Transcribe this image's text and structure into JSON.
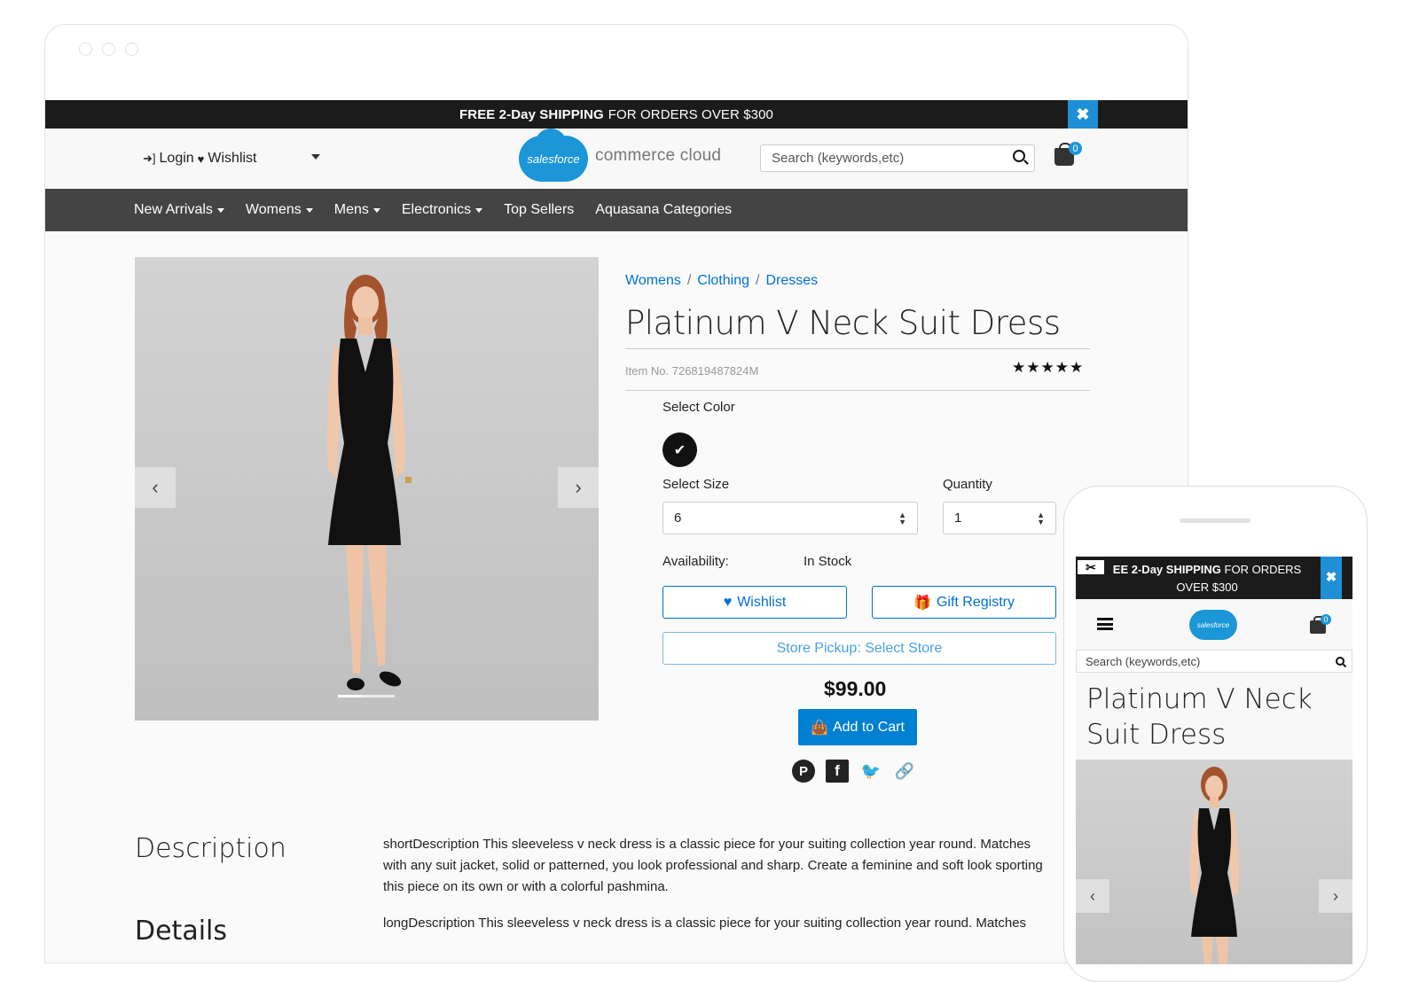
{
  "promo": {
    "bold": "FREE 2-Day SHIPPING",
    "rest": "FOR ORDERS OVER $300",
    "close": "✖"
  },
  "header": {
    "login": "Login",
    "wishlist": "Wishlist",
    "logo_cloud": "salesforce",
    "logo_text": "commerce cloud",
    "search_placeholder": "Search (keywords,etc)",
    "cart_count": "0"
  },
  "nav": {
    "items": [
      {
        "label": "New Arrivals",
        "dropdown": true
      },
      {
        "label": "Womens",
        "dropdown": true
      },
      {
        "label": "Mens",
        "dropdown": true
      },
      {
        "label": "Electronics",
        "dropdown": true
      },
      {
        "label": "Top Sellers",
        "dropdown": false
      },
      {
        "label": "Aquasana Categories",
        "dropdown": false
      }
    ]
  },
  "breadcrumb": [
    "Womens",
    "Clothing",
    "Dresses"
  ],
  "product": {
    "title": "Platinum V Neck Suit Dress",
    "item_no": "Item No. 726819487824M",
    "rating_stars": "★★★★★",
    "rating": 5,
    "select_color_label": "Select Color",
    "selected_color": "#111111",
    "select_size_label": "Select Size",
    "size_value": "6",
    "quantity_label": "Quantity",
    "quantity_value": "1",
    "availability_label": "Availability:",
    "availability_value": "In Stock",
    "wishlist_btn": "Wishlist",
    "gift_registry_btn": "Gift Registry",
    "store_pickup_btn": "Store Pickup: Select Store",
    "price": "$99.00",
    "add_to_cart": "Add to Cart"
  },
  "social": [
    "pinterest-icon",
    "facebook-icon",
    "twitter-icon",
    "link-icon"
  ],
  "description": {
    "heading": "Description",
    "text": "shortDescription This sleeveless v neck dress is a classic piece for your suiting collection year round. Matches with any suit jacket, solid or patterned, you look professional and sharp. Create a feminine and soft look sporting this piece on its own or with a colorful pashmina.",
    "details_heading": "Details",
    "long_text": "longDescription This sleeveless v neck dress is a classic piece for your suiting collection year round. Matches"
  },
  "mobile": {
    "promo_bold": "EE 2-Day SHIPPING",
    "promo_rest": "FOR ORDERS OVER $300",
    "close": "✖",
    "logo": "salesforce",
    "cart_count": "0",
    "search_placeholder": "Search (keywords,etc)",
    "title": "Platinum V Neck Suit Dress"
  },
  "colors": {
    "accent": "#0070d2",
    "nav_bg": "#444444",
    "promo_bg": "#1b1b1b",
    "brand": "#1b96d7"
  }
}
